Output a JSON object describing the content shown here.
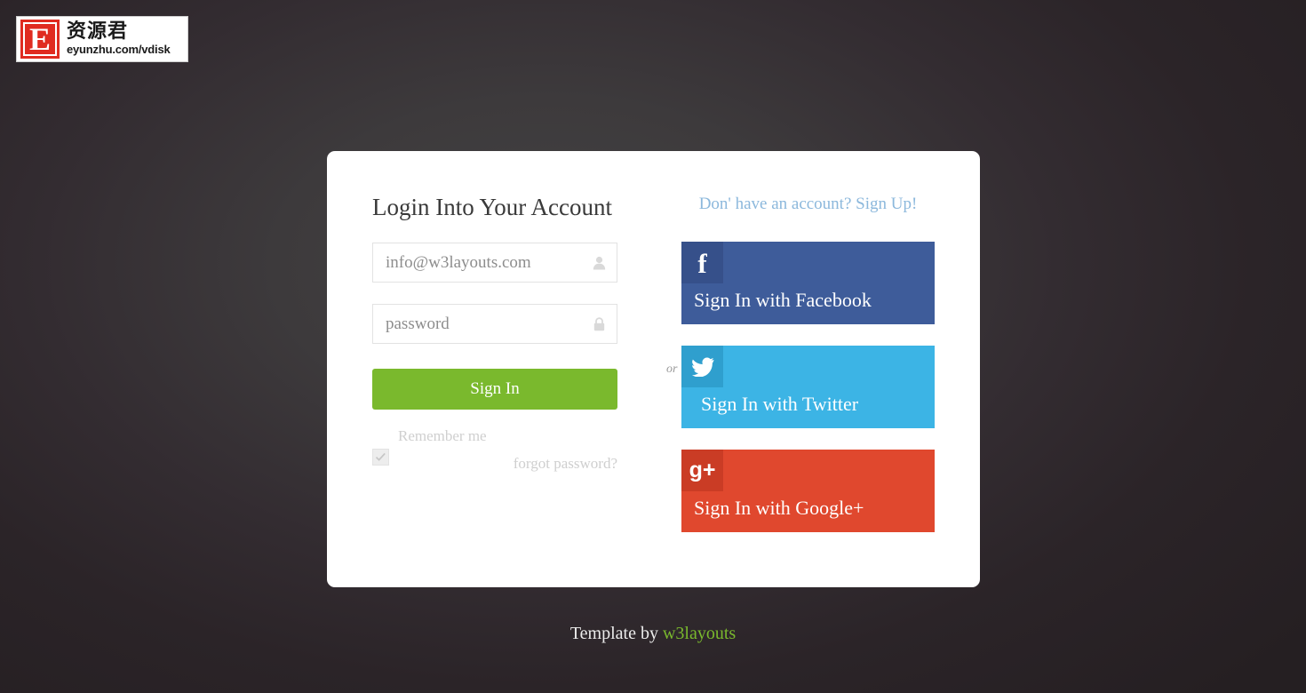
{
  "logo": {
    "initial": "E",
    "chinese_name": "资源君",
    "url": "eyunzhu.com/vdisk"
  },
  "login_form": {
    "title": "Login Into Your Account",
    "email_placeholder": "info@w3layouts.com",
    "email_value": "",
    "email_icon": "user-icon",
    "password_placeholder": "password",
    "password_value": "",
    "password_icon": "lock-icon",
    "submit_label": "Sign In",
    "remember_label": "Remember me",
    "remember_checked": true,
    "forgot_label": "forgot password?"
  },
  "signup": {
    "link_text": "Don' have an account? Sign Up!"
  },
  "divider": {
    "or_text": "or"
  },
  "social": [
    {
      "label": "Sign In with Facebook",
      "icon": "facebook-icon",
      "glyph": "f",
      "bg": "#3e5c9a",
      "icon_bg": "#36508a"
    },
    {
      "label": "Sign In with Twitter",
      "icon": "twitter-icon",
      "glyph": "",
      "bg": "#3cb4e5",
      "icon_bg": "#2f9fce"
    },
    {
      "label": "Sign In with Google+",
      "icon": "google-plus-icon",
      "glyph": "g+",
      "bg": "#e0482e",
      "icon_bg": "#ca3c25"
    }
  ],
  "footer": {
    "prefix": "Template by ",
    "brand": "w3layouts"
  },
  "colors": {
    "accent_green": "#7ab92d",
    "signup_blue": "#8cb8dc",
    "page_bg": "#2b2428",
    "card_bg": "#ffffff"
  }
}
